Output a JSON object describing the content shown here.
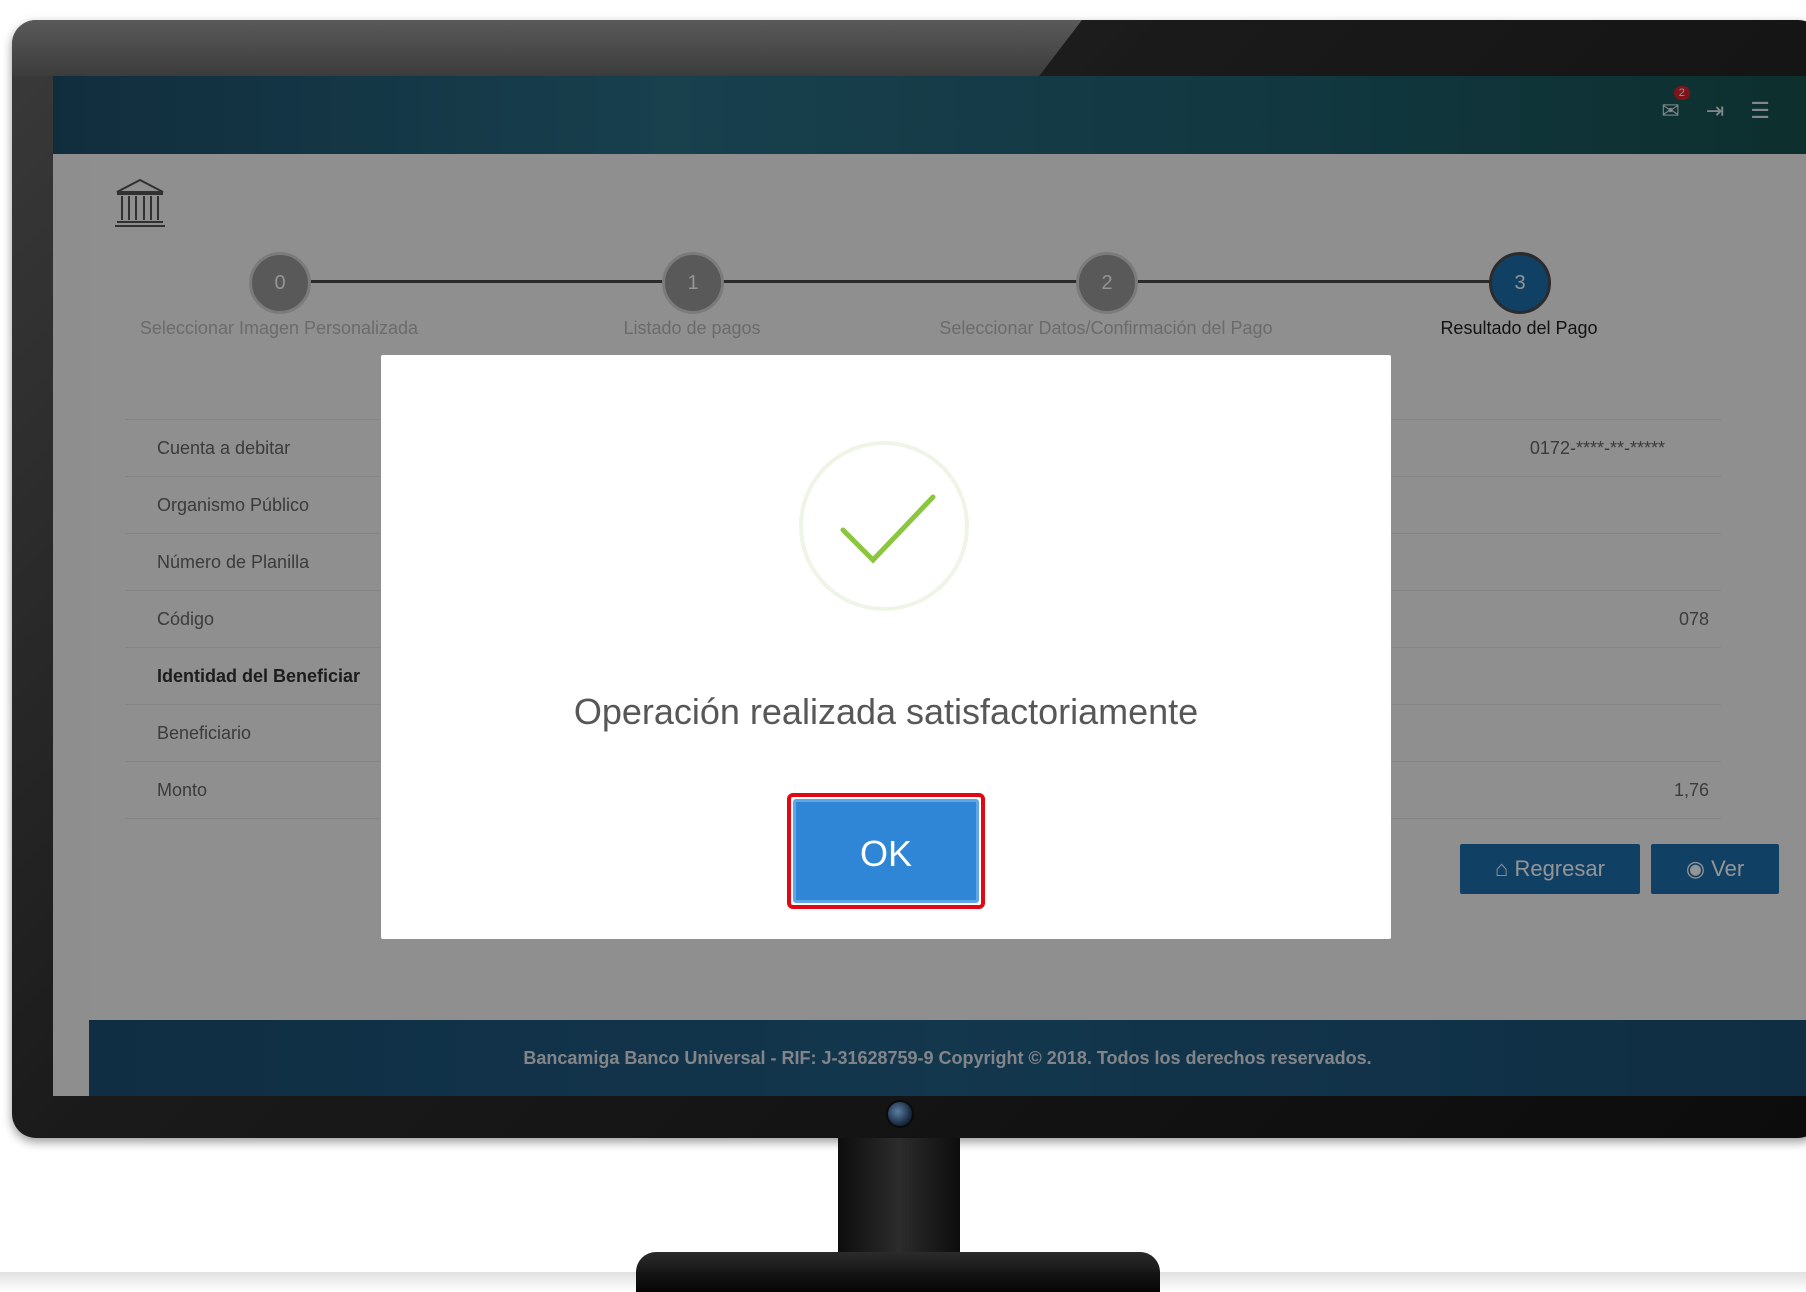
{
  "header": {
    "notification_count": "2"
  },
  "wizard": {
    "steps": [
      {
        "number": "0",
        "label": "Seleccionar Imagen Personalizada"
      },
      {
        "number": "1",
        "label": "Listado de pagos"
      },
      {
        "number": "2",
        "label": "Seleccionar Datos/Confirmación del Pago"
      },
      {
        "number": "3",
        "label": "Resultado del Pago"
      }
    ],
    "active_step": 3
  },
  "table": {
    "rows": [
      {
        "label": "Cuenta a debitar",
        "value": "0172-****-**-*****"
      },
      {
        "label": "Organismo Público",
        "value": ""
      },
      {
        "label": "Número de Planilla",
        "value": ""
      },
      {
        "label": "Código",
        "value": "078"
      },
      {
        "label": "Identidad del Beneficiar",
        "value": ""
      },
      {
        "label": "Beneficiario",
        "value": ""
      },
      {
        "label": "Monto",
        "value": "1,76"
      }
    ]
  },
  "actions": {
    "regresar_label": "Regresar",
    "ver_label": "Ver"
  },
  "footer": {
    "text": "Bancamiga Banco Universal - RIF: J-31628759-9 Copyright © 2018. Todos los derechos reservados."
  },
  "modal": {
    "message": "Operación realizada satisfactoriamente",
    "ok_label": "OK"
  },
  "colors": {
    "accent": "#1e6fae",
    "ok_button": "#2f86d6",
    "highlight": "#e30613",
    "check": "#8cc63f"
  }
}
